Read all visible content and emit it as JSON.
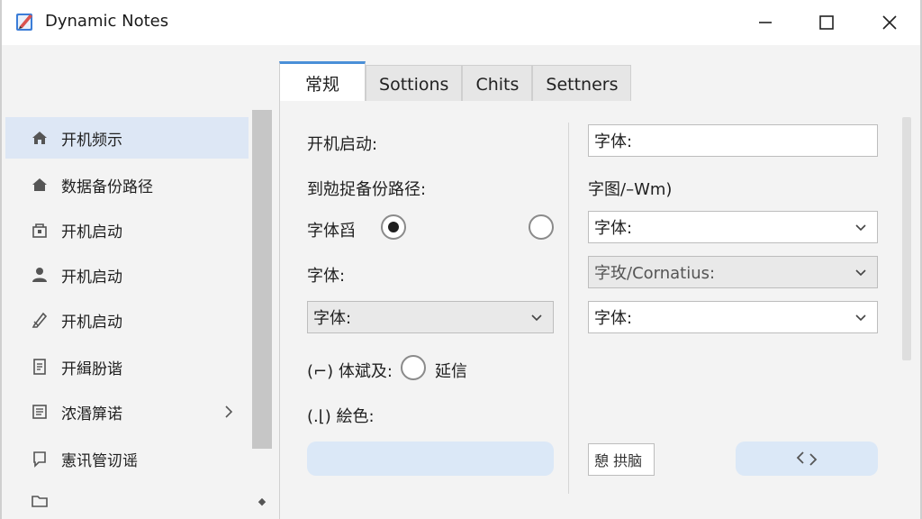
{
  "window": {
    "title": "Dynamic Notes",
    "icon": "notes-app-icon",
    "controls": [
      "minimize-icon",
      "maximize-icon",
      "close-icon"
    ]
  },
  "tabs": [
    {
      "label": "常规",
      "active": true
    },
    {
      "label": "Sottions",
      "active": false
    },
    {
      "label": "Chits",
      "active": false
    },
    {
      "label": "Settners",
      "active": false
    }
  ],
  "sidebar": {
    "items": [
      {
        "label": "开机频示",
        "icon": "home-icon",
        "selected": true
      },
      {
        "label": "数据备份路径",
        "icon": "house-icon",
        "selected": false
      },
      {
        "label": "开机启动",
        "icon": "lock-box-icon",
        "selected": false
      },
      {
        "label": "开机启动",
        "icon": "user-icon",
        "selected": false
      },
      {
        "label": "开机启动",
        "icon": "pen-icon",
        "selected": false
      },
      {
        "label": "开緝肦谐",
        "icon": "document-icon",
        "selected": false
      },
      {
        "label": "浓湣箳诺",
        "icon": "notes-icon",
        "has_submenu": true,
        "selected": false
      },
      {
        "label": "憲讯管讱谣",
        "icon": "chat-icon",
        "selected": false
      },
      {
        "label": "",
        "icon": "folder-icon",
        "selected": false
      }
    ]
  },
  "settings_left": {
    "startup_label": "开机启动:",
    "backup_label": "到勊捉备份路径:",
    "font_radio_label": "字体舀",
    "font_radio_checked": true,
    "font_label": "字体:",
    "font_select": "字体:",
    "size_prefix": "(⌐) 体斌及:",
    "size_option": "延信",
    "color_label": "(.⌊) 絵色:"
  },
  "settings_right": {
    "font_input": "字体:",
    "size_label": "字图/–Wm)",
    "font_select_1": "字体:",
    "font_select_2": "字玫/Cornatius:",
    "font_select_3": "字体:",
    "small_button": "憩 拱脑",
    "action_icon": "swap-arrows-icon"
  }
}
